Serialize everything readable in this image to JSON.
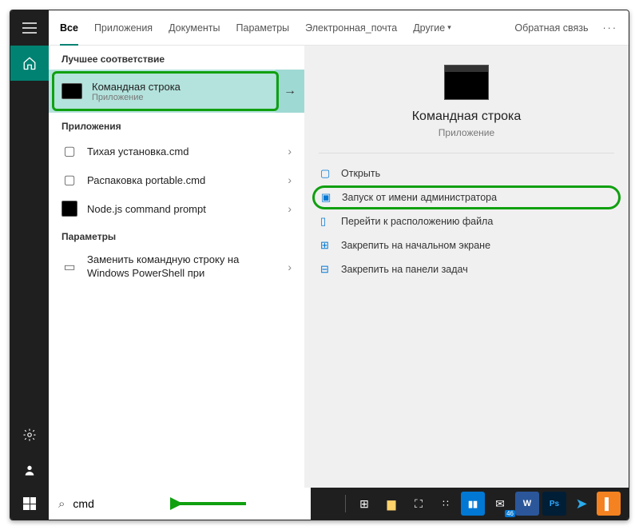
{
  "tabs": {
    "items": [
      "Все",
      "Приложения",
      "Документы",
      "Параметры",
      "Электронная_почта",
      "Другие"
    ],
    "feedback": "Обратная связь"
  },
  "sections": {
    "best": "Лучшее соответствие",
    "apps": "Приложения",
    "settings": "Параметры"
  },
  "best_match": {
    "title": "Командная строка",
    "subtitle": "Приложение"
  },
  "apps": [
    {
      "label": "Тихая установка.cmd"
    },
    {
      "label": "Распаковка portable.cmd"
    },
    {
      "label": "Node.js command prompt"
    }
  ],
  "settings_item": {
    "label": "Заменить командную строку на Windows PowerShell при"
  },
  "preview": {
    "title": "Командная строка",
    "subtitle": "Приложение",
    "actions": [
      "Открыть",
      "Запуск от имени администратора",
      "Перейти к расположению файла",
      "Закрепить на начальном экране",
      "Закрепить на панели задач"
    ]
  },
  "search": {
    "value": "cmd",
    "placeholder": ""
  }
}
